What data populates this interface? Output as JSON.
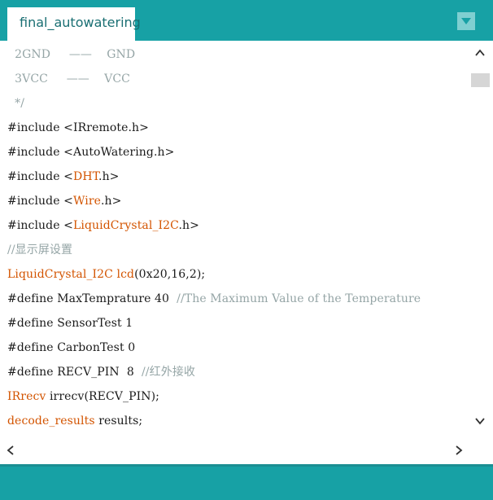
{
  "tab": {
    "title": "final_autowatering"
  },
  "icons": {
    "tab_menu": "triangle-down-icon",
    "scroll_up": "chevron-up-icon",
    "scroll_down": "chevron-down-icon",
    "scroll_left": "chevron-left-icon",
    "scroll_right": "chevron-right-icon"
  },
  "colors": {
    "teal": "#17a1a5",
    "library_orange": "#d35400",
    "comment_gray": "#95a5a6"
  },
  "code": {
    "l1_a": "  2GND",
    "l1_b": "     ——    ",
    "l1_c": "GND",
    "l2_a": "  3VCC",
    "l2_b": "     ——    ",
    "l2_c": "VCC",
    "l3": "  */",
    "l4_a": "#include ",
    "l4_b": "<IRremote.h>",
    "l5_a": "#include ",
    "l5_b": "<AutoWatering.h>",
    "l6_a": "#include <",
    "l6_b": "DHT",
    "l6_c": ".h>",
    "l7_a": "#include <",
    "l7_b": "Wire",
    "l7_c": ".h>",
    "l8_a": "#include <",
    "l8_b": "LiquidCrystal_I2C",
    "l8_c": ".h>",
    "l9": "//显示屏设置",
    "l10_a": "LiquidCrystal_I2C lcd",
    "l10_b": "(0x20,16,2);",
    "l11_a": "#define MaxTemprature 40  ",
    "l11_b": "//The Maximum Value of the Temperature",
    "l12": "#define SensorTest 1",
    "l13": "#define CarbonTest 0",
    "l14_a": "#define RECV_PIN  8  ",
    "l14_b": "//红外接收",
    "l15_a": "IRrecv",
    "l15_b": " irrecv(RECV_PIN);",
    "l16_a": "decode_results",
    "l16_b": " results;"
  }
}
